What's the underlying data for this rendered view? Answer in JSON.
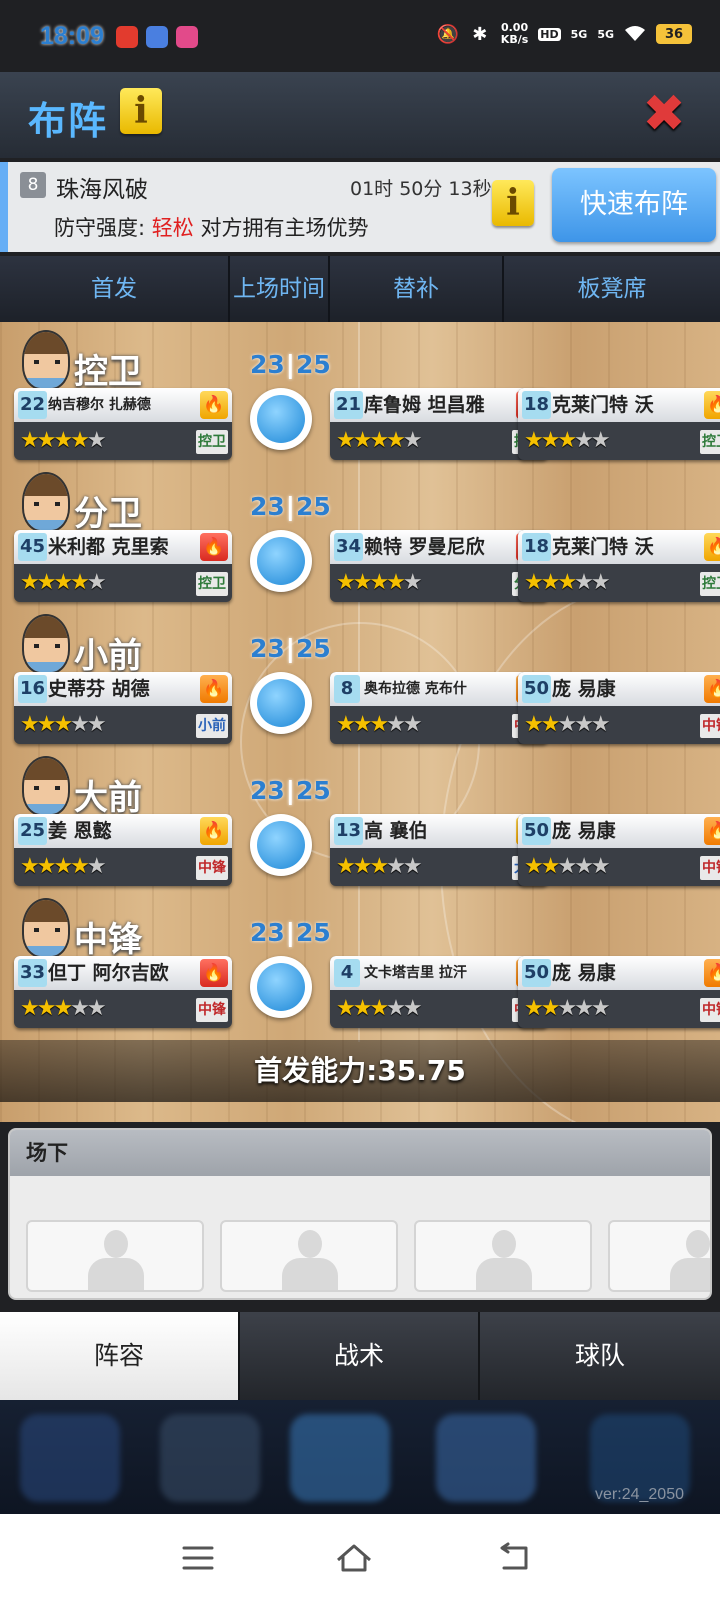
{
  "status_bar": {
    "time": "18:09",
    "speed_value": "0.00",
    "speed_unit": "KB/s",
    "hd": "HD",
    "sim1": "5G",
    "sim2": "5G",
    "battery": "36"
  },
  "header": {
    "title": "布阵",
    "info_icon": "i",
    "close_icon": "✖"
  },
  "match": {
    "level": "8",
    "opponent": "珠海风破",
    "countdown": "01时 50分 13秒",
    "defense_label": "防守强度:",
    "defense_value": "轻松",
    "home_note": "对方拥有主场优势",
    "quick_button": "快速布阵",
    "info_icon": "i"
  },
  "sub_tabs": [
    "首发",
    "上场时间",
    "替补",
    "板凳席"
  ],
  "positions": [
    {
      "pos": "控卫",
      "time_a": "23",
      "time_b": "25",
      "starter": {
        "num": "22",
        "name": "纳吉穆尔 扎赫德",
        "form": "gold",
        "stars": 4,
        "max": 5,
        "tag": "控卫",
        "tag_color": "#2e7a3a"
      },
      "sub1": {
        "num": "21",
        "name": "库鲁姆 坦昌雅",
        "form": "red",
        "stars": 4,
        "max": 5,
        "tag": "控卫",
        "tag_color": "#2e7a3a"
      },
      "sub2": {
        "num": "18",
        "name": "克莱门特 沃",
        "form": "gold",
        "stars": 3,
        "max": 5,
        "tag": "控卫",
        "tag_color": "#2e7a3a"
      }
    },
    {
      "pos": "分卫",
      "time_a": "23",
      "time_b": "25",
      "starter": {
        "num": "45",
        "name": "米利都 克里索",
        "form": "red",
        "stars": 4,
        "max": 5,
        "tag": "控卫",
        "tag_color": "#2e7a3a"
      },
      "sub1": {
        "num": "34",
        "name": "赖特 罗曼尼欣",
        "form": "red",
        "stars": 4,
        "max": 5,
        "tag": "分卫",
        "tag_color": "#2e7a3a"
      },
      "sub2": {
        "num": "18",
        "name": "克莱门特 沃",
        "form": "gold",
        "stars": 3,
        "max": 5,
        "tag": "控卫",
        "tag_color": "#2e7a3a"
      }
    },
    {
      "pos": "小前",
      "time_a": "23",
      "time_b": "25",
      "starter": {
        "num": "16",
        "name": "史蒂芬 胡德",
        "form": "orange",
        "stars": 3,
        "max": 5,
        "tag": "小前",
        "tag_color": "#2a62b8"
      },
      "sub1": {
        "num": "8",
        "name": "奥布拉德 克布什",
        "form": "orange",
        "stars": 3,
        "max": 5,
        "tag": "中锋",
        "tag_color": "#c0282a"
      },
      "sub2": {
        "num": "50",
        "name": "庞 易康",
        "form": "orange",
        "stars": 2,
        "max": 5,
        "tag": "中锋",
        "tag_color": "#c0282a"
      }
    },
    {
      "pos": "大前",
      "time_a": "23",
      "time_b": "25",
      "starter": {
        "num": "25",
        "name": "姜 恩懿",
        "form": "gold",
        "stars": 4,
        "max": 5,
        "tag": "中锋",
        "tag_color": "#c0282a"
      },
      "sub1": {
        "num": "13",
        "name": "高 襄伯",
        "form": "gold",
        "stars": 3,
        "max": 5,
        "tag": "大前",
        "tag_color": "#2a62b8"
      },
      "sub2": {
        "num": "50",
        "name": "庞 易康",
        "form": "orange",
        "stars": 2,
        "max": 5,
        "tag": "中锋",
        "tag_color": "#c0282a"
      }
    },
    {
      "pos": "中锋",
      "time_a": "23",
      "time_b": "25",
      "starter": {
        "num": "33",
        "name": "但丁 阿尔吉欧",
        "form": "red",
        "stars": 3,
        "max": 5,
        "tag": "中锋",
        "tag_color": "#c0282a"
      },
      "sub1": {
        "num": "4",
        "name": "文卡塔吉里 拉汗",
        "form": "orange",
        "stars": 3,
        "max": 5,
        "tag": "中锋",
        "tag_color": "#c0282a"
      },
      "sub2": {
        "num": "50",
        "name": "庞 易康",
        "form": "orange",
        "stars": 2,
        "max": 5,
        "tag": "中锋",
        "tag_color": "#c0282a"
      }
    }
  ],
  "starting_power": "首发能力:35.75",
  "bench": {
    "title": "场下",
    "slots": 4
  },
  "bottom_tabs": [
    "阵容",
    "战术",
    "球队"
  ],
  "version": "ver:24_2050",
  "colors": {
    "accent_blue": "#5ab8ff",
    "quick_button": "#3e95e8",
    "info_yellow": "#f2c200",
    "easy_red": "#e02020"
  }
}
